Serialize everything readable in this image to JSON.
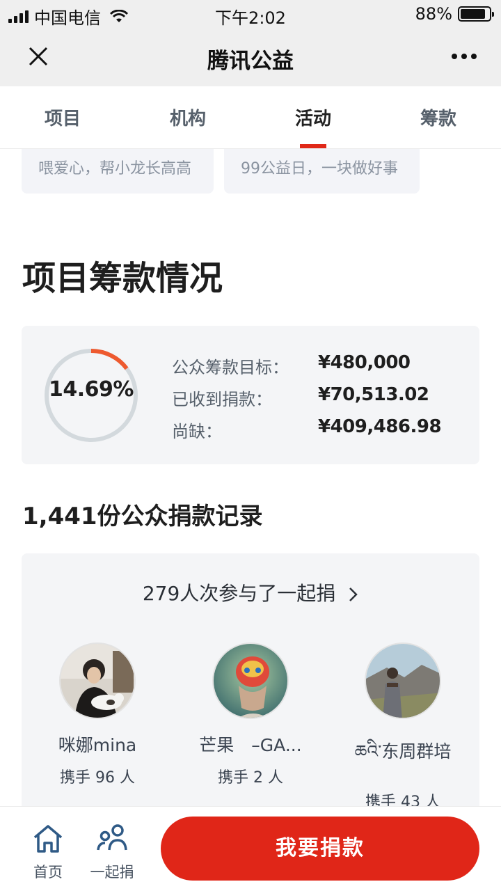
{
  "status_bar": {
    "carrier": "中国电信",
    "time": "下午2:02",
    "battery": "88%",
    "battery_level": 0.88
  },
  "nav": {
    "title": "腾讯公益",
    "close_icon": "close-icon",
    "more_icon": "more-dots-icon"
  },
  "tabs": [
    {
      "label": "项目",
      "active": false
    },
    {
      "label": "机构",
      "active": false
    },
    {
      "label": "活动",
      "active": true
    },
    {
      "label": "筹款",
      "active": false
    }
  ],
  "activity_cards": [
    {
      "text": "喂爱心，帮小龙长高高"
    },
    {
      "text": "99公益日，一块做好事"
    }
  ],
  "fundraising": {
    "title": "项目筹款情况",
    "percent_text": "14.69%",
    "progress": 0.1469,
    "rows": [
      {
        "label": "公众筹款目标：",
        "value": "¥480,000"
      },
      {
        "label": "已收到捐款：",
        "value": "¥70,513.02"
      },
      {
        "label": "尚缺：",
        "value": "¥409,486.98"
      }
    ],
    "accent_color": "#ee5a2f"
  },
  "records": {
    "title": "1,441份公众捐款记录"
  },
  "together": {
    "header": "279人次参与了一起捐",
    "donors": [
      {
        "name": "咪娜mina",
        "sub": "携手 96 人"
      },
      {
        "name": "芒果　–GA...",
        "sub": "携手 2 人"
      },
      {
        "name": "ཆའི་东周群培",
        "sub": "携手 43 人"
      }
    ]
  },
  "bottom_bar": {
    "home_label": "首页",
    "together_label": "一起捐",
    "donate_label": "我要捐款",
    "brand_color": "#e02618"
  }
}
